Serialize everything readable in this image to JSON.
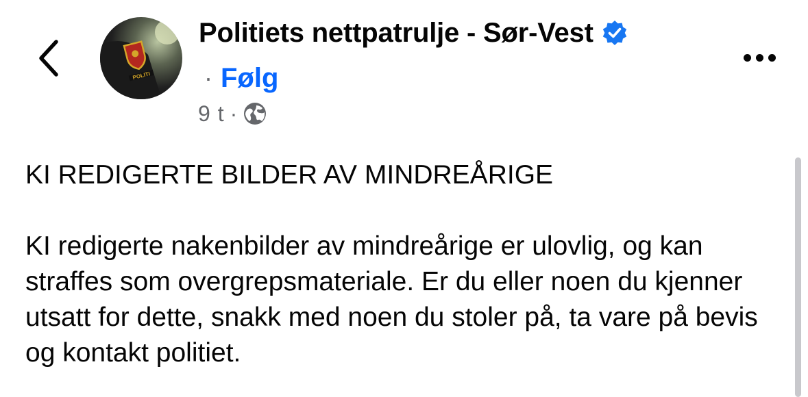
{
  "header": {
    "back_icon": "chevron-left-icon",
    "page_name": "Politiets nettpatrulje - Sør-Vest",
    "verified_icon": "verified-badge-icon",
    "separator": "·",
    "follow_label": "Følg",
    "time": "9 t",
    "meta_separator": "·",
    "audience_icon": "globe-icon",
    "more_icon": "more-horizontal-icon",
    "avatar_badge_text": "POLITI"
  },
  "post": {
    "heading": "KI REDIGERTE BILDER AV MINDREÅRIGE",
    "text": "KI redigerte nakenbilder av mindreårige er ulovlig, og kan straffes som overgrepsmateriale. Er du eller noen du kjenner utsatt for dette, snakk med noen du stoler på, ta vare på bevis og kontakt politiet."
  },
  "colors": {
    "text": "#050505",
    "secondary_text": "#65676b",
    "link_blue": "#0866ff",
    "verified_blue": "#1877f2",
    "scrollbar": "#c8c8cc"
  }
}
